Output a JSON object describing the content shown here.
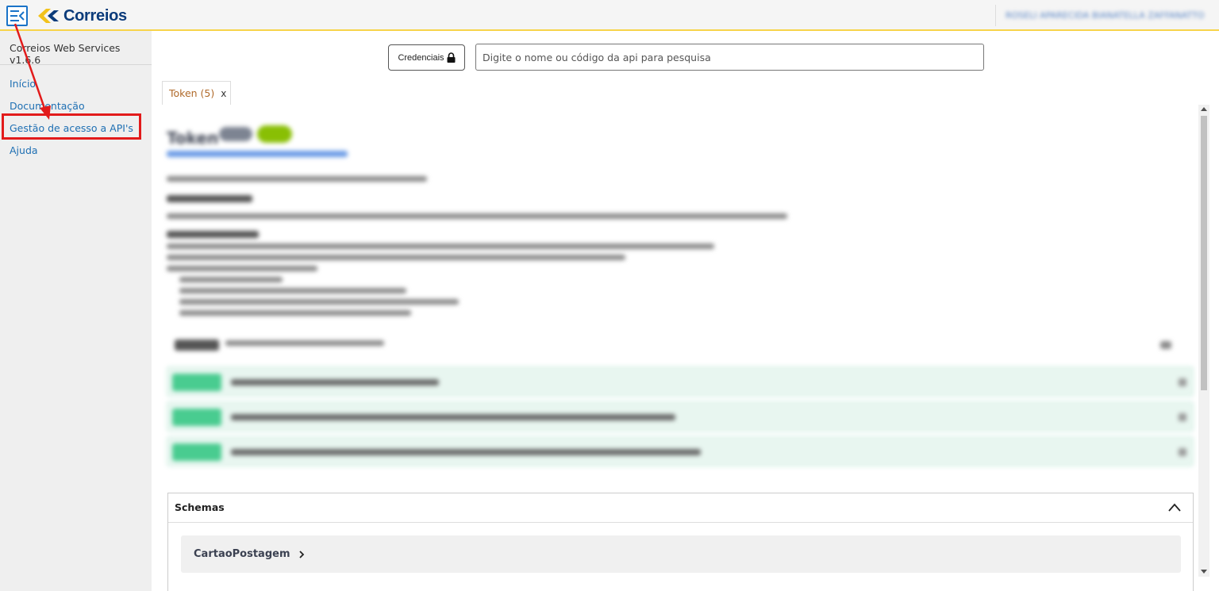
{
  "header": {
    "logo_text": "Correios",
    "user_name": "ROSELI APARECIDA BIANATELLA ZAFFANATTO"
  },
  "sidebar": {
    "title": "Correios Web Services v1.6.6",
    "items": [
      {
        "label": "Início"
      },
      {
        "label": "Documentação"
      },
      {
        "label": "Gestão de acesso a API's"
      },
      {
        "label": "Ajuda"
      }
    ]
  },
  "toolbar": {
    "credentials_label": "Credenciais",
    "search_placeholder": "Digite o nome ou código da api para pesquisa"
  },
  "tabs": [
    {
      "label": "Token (5)",
      "close": "x"
    }
  ],
  "api": {
    "title": "Token"
  },
  "schemas": {
    "title": "Schemas",
    "items": [
      {
        "name": "CartaoPostagem"
      }
    ]
  },
  "colors": {
    "accent": "#f7d44a",
    "link": "#1e6fb3",
    "annotation": "#e21b1b",
    "method_green": "#49cc90"
  }
}
